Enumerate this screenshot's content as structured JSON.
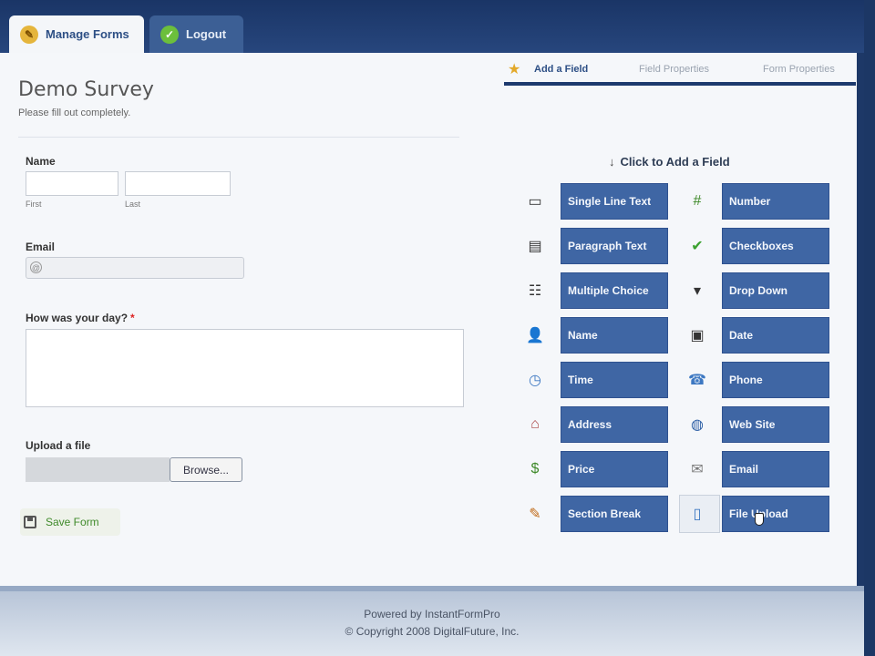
{
  "tabs": {
    "manage_forms": "Manage Forms",
    "logout": "Logout"
  },
  "form": {
    "title": "Demo Survey",
    "description": "Please fill out completely.",
    "fields": {
      "name_label": "Name",
      "first_sub": "First",
      "last_sub": "Last",
      "email_label": "Email",
      "email_icon": "@",
      "day_label": "How was your day?",
      "required_mark": "*",
      "upload_label": "Upload a file",
      "browse_button": "Browse..."
    },
    "save_button": "Save Form"
  },
  "builder": {
    "tabs": [
      "Add a Field",
      "Field Properties",
      "Form Properties"
    ],
    "active_tab": "Add a Field",
    "heading": "Click to Add a Field",
    "field_types": [
      {
        "label": "Single Line Text",
        "icon": "text-line-icon"
      },
      {
        "label": "Number",
        "icon": "number-icon"
      },
      {
        "label": "Paragraph Text",
        "icon": "paragraph-icon"
      },
      {
        "label": "Checkboxes",
        "icon": "checkmark-icon"
      },
      {
        "label": "Multiple Choice",
        "icon": "multiple-choice-icon"
      },
      {
        "label": "Drop Down",
        "icon": "dropdown-icon"
      },
      {
        "label": "Name",
        "icon": "person-icon"
      },
      {
        "label": "Date",
        "icon": "calendar-icon"
      },
      {
        "label": "Time",
        "icon": "clock-icon"
      },
      {
        "label": "Phone",
        "icon": "phone-icon"
      },
      {
        "label": "Address",
        "icon": "house-icon"
      },
      {
        "label": "Web Site",
        "icon": "globe-icon"
      },
      {
        "label": "Price",
        "icon": "dollar-icon"
      },
      {
        "label": "Email",
        "icon": "email-icon"
      },
      {
        "label": "Section Break",
        "icon": "pencil-icon"
      },
      {
        "label": "File Upload",
        "icon": "file-icon"
      }
    ]
  },
  "footer": {
    "powered_by": "Powered by InstantFormPro",
    "copyright": "© Copyright 2008 DigitalFuture, Inc."
  },
  "colors": {
    "navy": "#1f3b6b",
    "button_blue": "#3f66a4",
    "accent_green": "#3f8a2a"
  }
}
